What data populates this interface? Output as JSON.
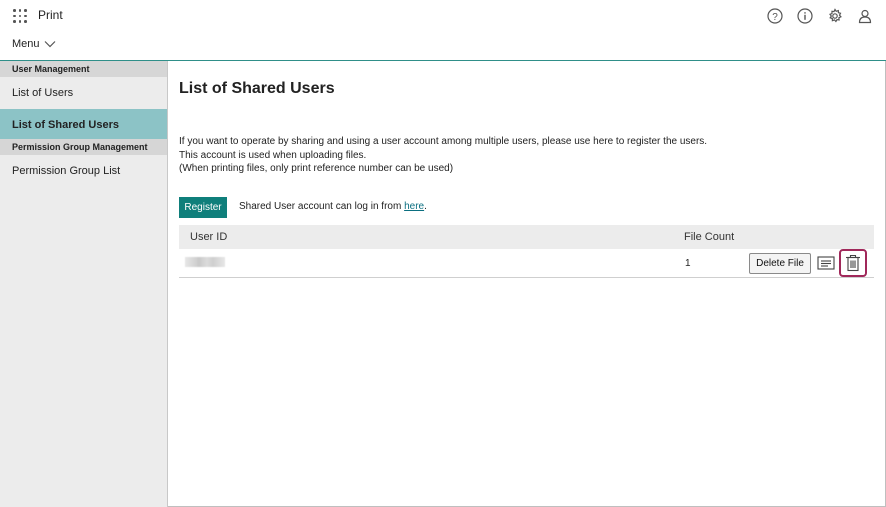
{
  "header": {
    "app_title": "Print",
    "menu_label": "Menu",
    "icons": [
      "help-icon",
      "info-icon",
      "gear-icon",
      "user-icon"
    ]
  },
  "sidebar": {
    "sections": [
      {
        "title": "User Management",
        "items": [
          {
            "label": "List of Users",
            "active": false
          },
          {
            "label": "List of Shared Users",
            "active": true
          }
        ]
      },
      {
        "title": "Permission Group Management",
        "items": [
          {
            "label": "Permission Group List",
            "active": false
          }
        ]
      }
    ]
  },
  "main": {
    "page_title": "List of Shared Users",
    "description_lines": [
      "If you want to operate by sharing and using a user account among multiple users, please use here to register the users.",
      "This account is used when uploading files.",
      "(When printing files, only print reference number can be used)"
    ],
    "register_label": "Register",
    "login_text": "Shared User account can log in from ",
    "login_link": "here",
    "login_suffix": ".",
    "table": {
      "columns": [
        "User ID",
        "File Count"
      ],
      "rows": [
        {
          "user_id": "",
          "file_count": "1"
        }
      ],
      "delete_file_label": "Delete File"
    }
  },
  "colors": {
    "accent": "#0f7f7b",
    "active_item": "#8cc3c6",
    "highlight_border": "#a0285a"
  }
}
